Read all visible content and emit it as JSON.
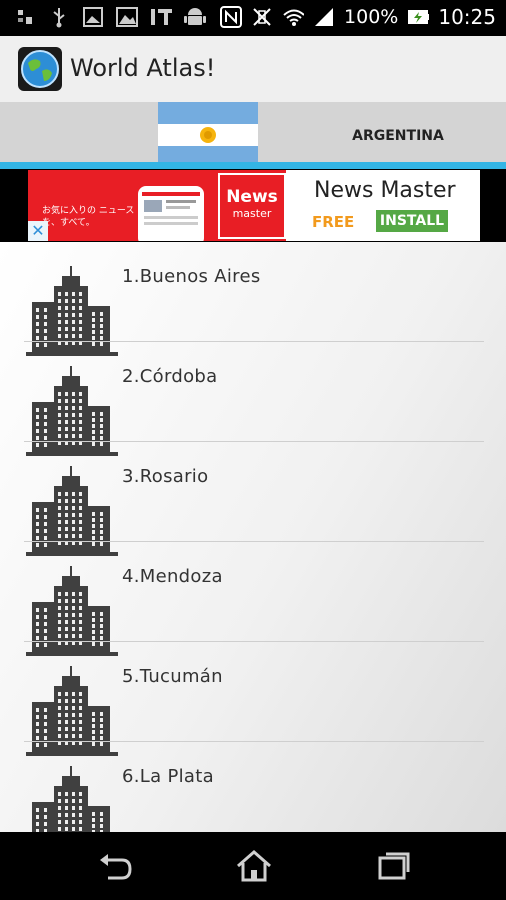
{
  "status_bar": {
    "battery_percent": "100%",
    "time": "10:25",
    "icons": [
      "usb-debug-icon",
      "usb-icon",
      "image-icon",
      "image-icon",
      "it-icon",
      "android-icon",
      "nfc-icon",
      "vibrate-off-icon",
      "wifi-icon",
      "signal-icon",
      "battery-icon"
    ]
  },
  "app_bar": {
    "title": "World Atlas!"
  },
  "country": {
    "name": "ARGENTINA"
  },
  "ad": {
    "jp_text": "お気に入りの ニュースを、すべて。",
    "logo_line1": "News",
    "logo_line2": "master",
    "name": "News Master",
    "price": "FREE",
    "install_label": "INSTALL",
    "close_label": "✕"
  },
  "cities": [
    {
      "label": "1.Buenos Aires"
    },
    {
      "label": "2.Córdoba"
    },
    {
      "label": "3.Rosario"
    },
    {
      "label": "4.Mendoza"
    },
    {
      "label": "5.Tucumán"
    },
    {
      "label": "6.La Plata"
    }
  ],
  "colors": {
    "accent": "#33b5e5",
    "flag_blue": "#74acdf",
    "flag_sun": "#f6b40e",
    "ad_red": "#e81e25",
    "install_green": "#55a845",
    "free_orange": "#f29a1d"
  }
}
